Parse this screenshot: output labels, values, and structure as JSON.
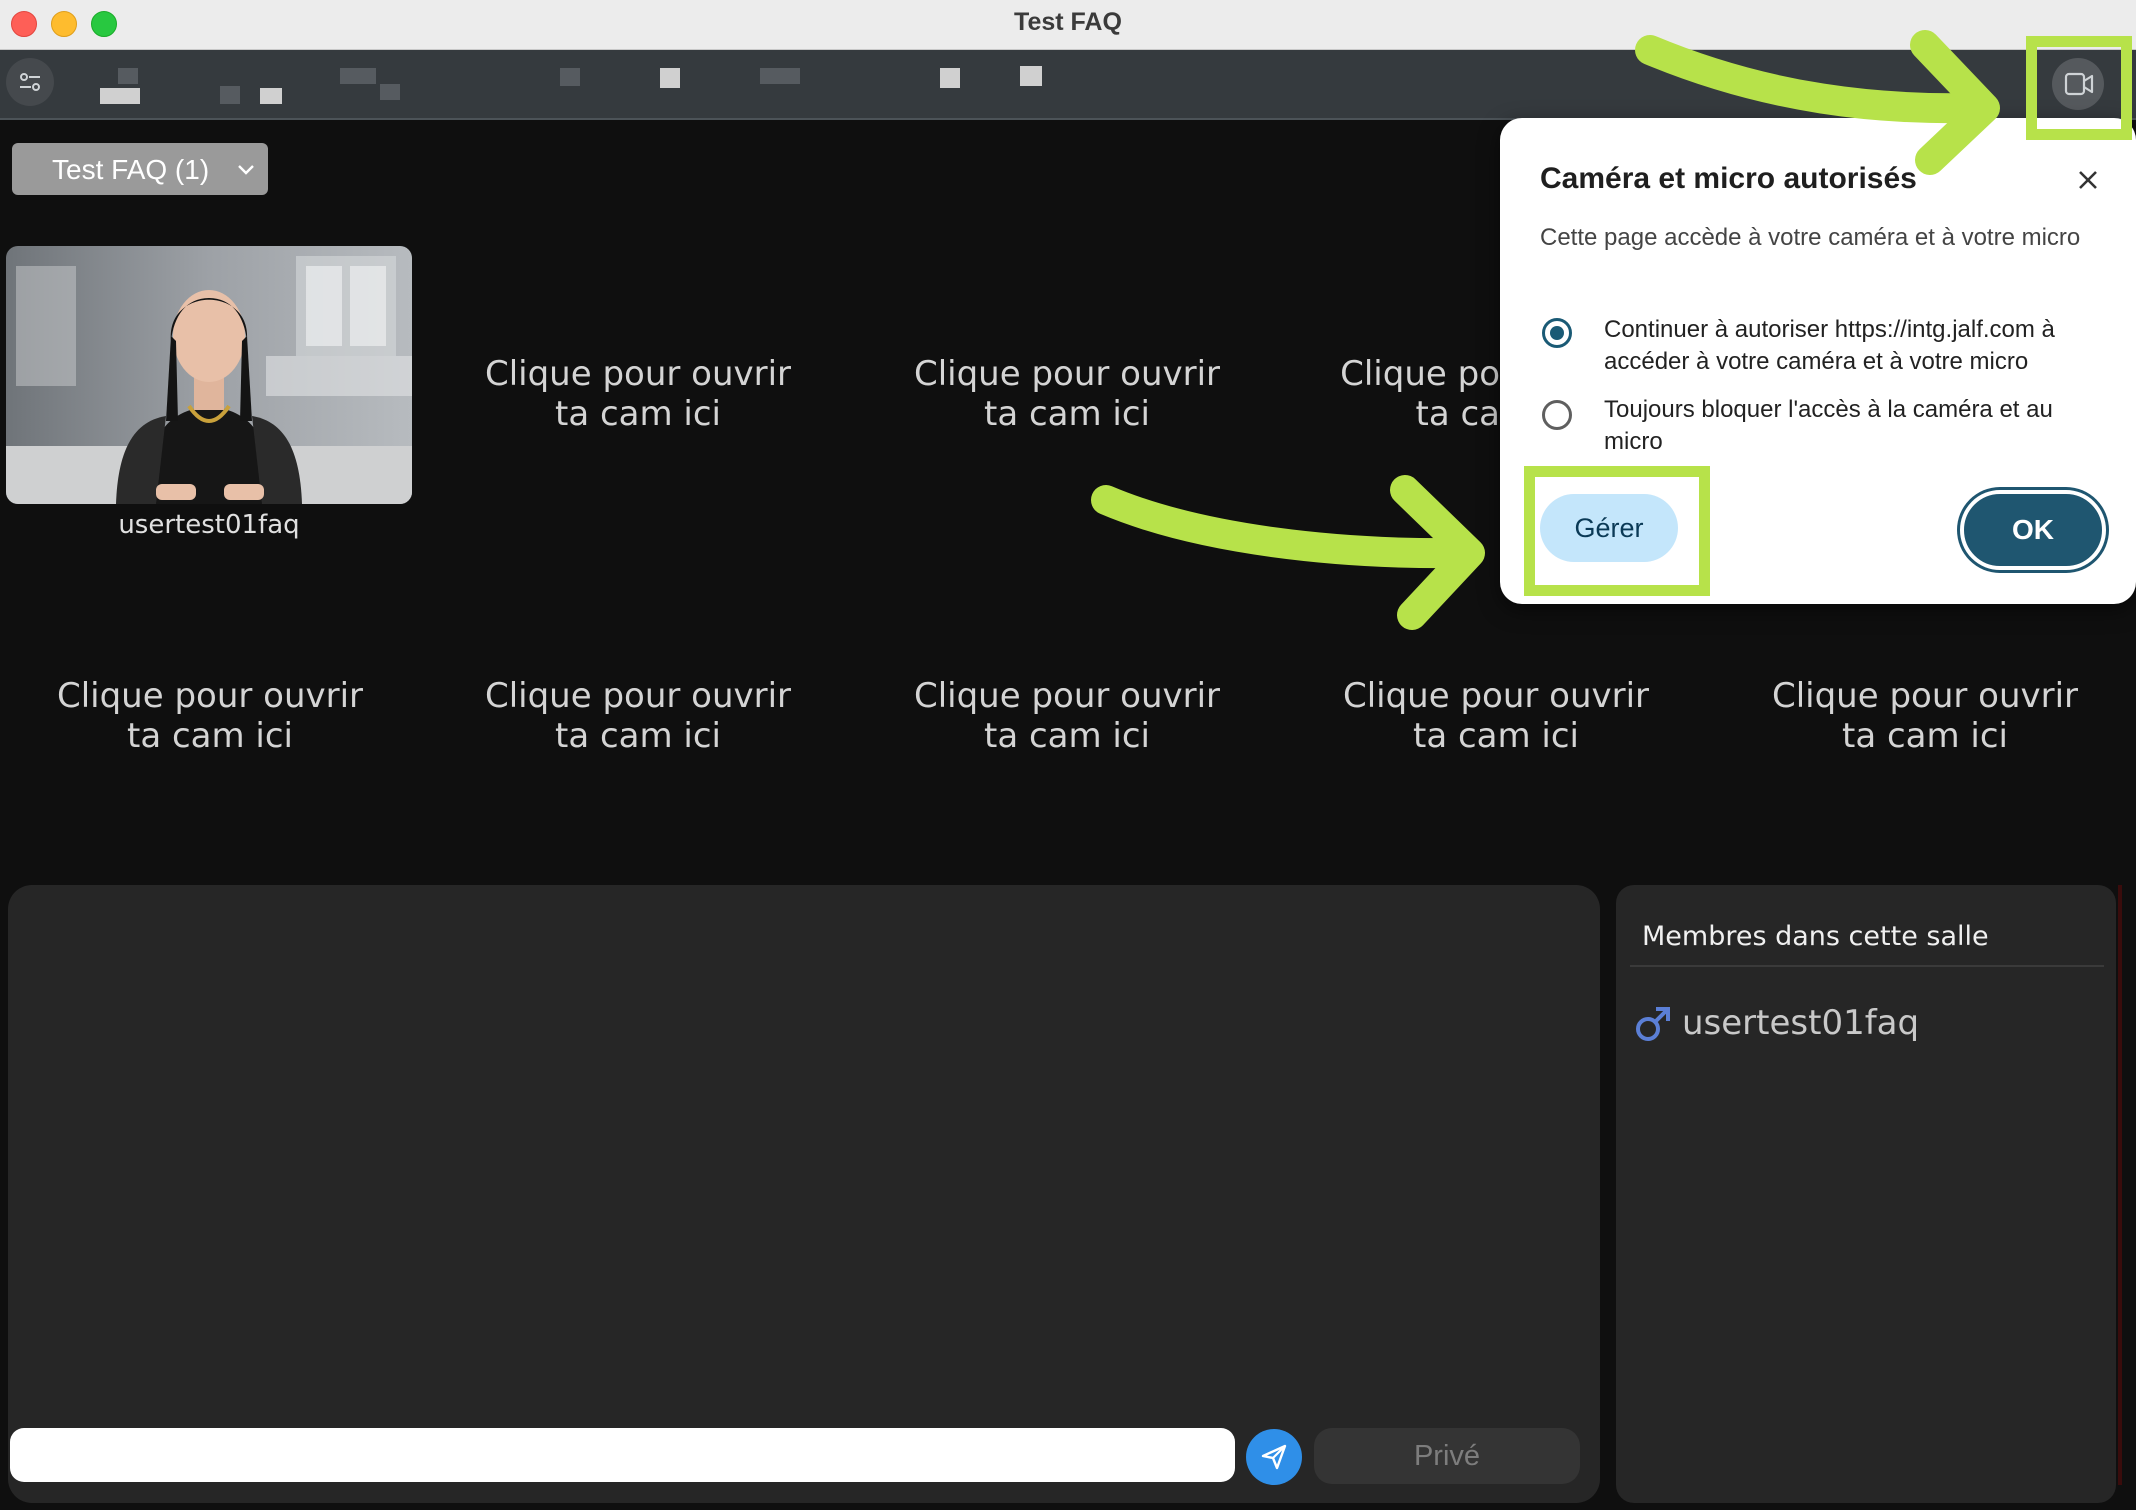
{
  "window": {
    "title": "Test FAQ"
  },
  "room": {
    "selector_label": "Test FAQ (1)"
  },
  "cams": {
    "active_user": "usertest01faq",
    "slots_row1": [
      {
        "line1": "Clique pour ouvrir",
        "line2": "ta cam ici"
      },
      {
        "line1": "Clique pour ouvrir",
        "line2": "ta cam ici"
      },
      {
        "line1": "Clique po",
        "line2": "ta ca"
      }
    ],
    "slots_row2": [
      {
        "line1": "Clique pour ouvrir",
        "line2": "ta cam ici"
      },
      {
        "line1": "Clique pour ouvrir",
        "line2": "ta cam ici"
      },
      {
        "line1": "Clique pour ouvrir",
        "line2": "ta cam ici"
      },
      {
        "line1": "Clique pour ouvrir",
        "line2": "ta cam ici"
      },
      {
        "line1": "Clique pour ouvrir",
        "line2": "ta cam ici"
      }
    ]
  },
  "chat": {
    "input_value": "",
    "private_label": "Privé"
  },
  "members": {
    "title": "Membres dans cette salle",
    "list": [
      {
        "name": "usertest01faq",
        "gender_icon": "male-icon",
        "icon_color": "#5b7fd6"
      }
    ]
  },
  "permission_popup": {
    "title": "Caméra et micro autorisés",
    "description": "Cette page accède à votre caméra et à votre micro",
    "options": [
      {
        "label": "Continuer à autoriser https://intg.jalf.com à accéder à votre caméra et à votre micro",
        "selected": true
      },
      {
        "label": "Toujours bloquer l'accès à la caméra et au micro",
        "selected": false
      }
    ],
    "manage_label": "Gérer",
    "ok_label": "OK"
  },
  "colors": {
    "annotation": "#b7e24a",
    "primary": "#1f5670",
    "manage_bg": "#c4e6fb",
    "send": "#2f8fe8"
  }
}
